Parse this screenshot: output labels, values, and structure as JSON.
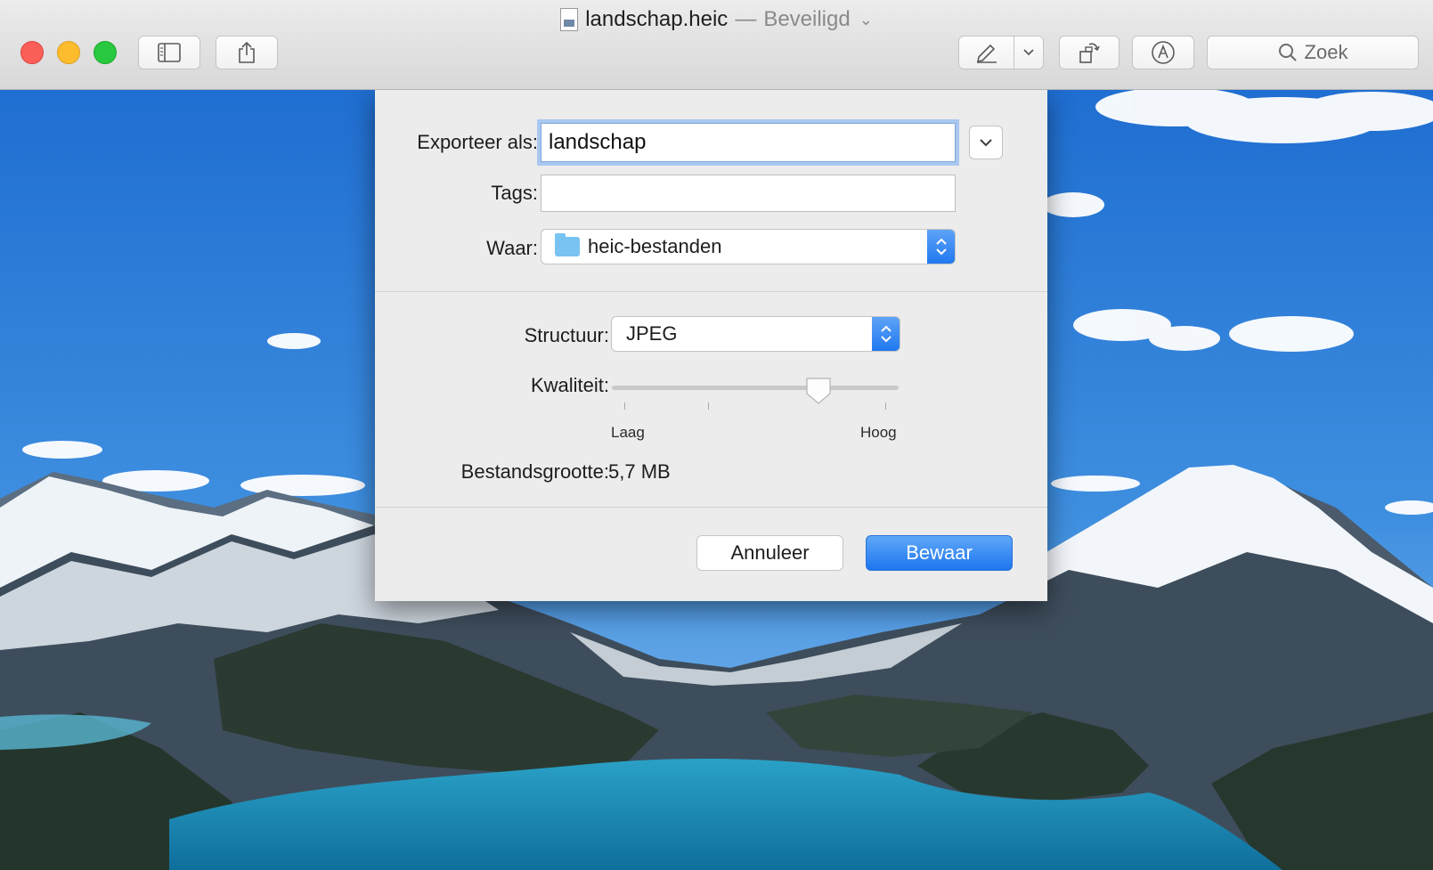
{
  "window": {
    "filename": "landschap.heic",
    "separator": "—",
    "status": "Beveiligd"
  },
  "toolbar": {
    "search_label": "Zoek",
    "icons": [
      "sidebar-icon",
      "share-icon",
      "markup-pen-icon",
      "chevron-down-icon",
      "rotate-icon",
      "annotate-icon",
      "search-icon"
    ]
  },
  "dialog": {
    "export_as_label": "Exporteer als:",
    "export_as_value": "landschap",
    "tags_label": "Tags:",
    "tags_value": "",
    "where_label": "Waar:",
    "where_value": "heic-bestanden",
    "format_label": "Structuur:",
    "format_value": "JPEG",
    "quality_label": "Kwaliteit:",
    "quality_fraction": 0.72,
    "quality_min_label": "Laag",
    "quality_max_label": "Hoog",
    "filesize_label": "Bestandsgrootte:",
    "filesize_value": "5,7 MB",
    "cancel_label": "Annuleer",
    "save_label": "Bewaar"
  },
  "colors": {
    "accent": "#1f77f0",
    "close": "#fc5f57",
    "minimize": "#fdbc2e",
    "maximize": "#28c840"
  }
}
